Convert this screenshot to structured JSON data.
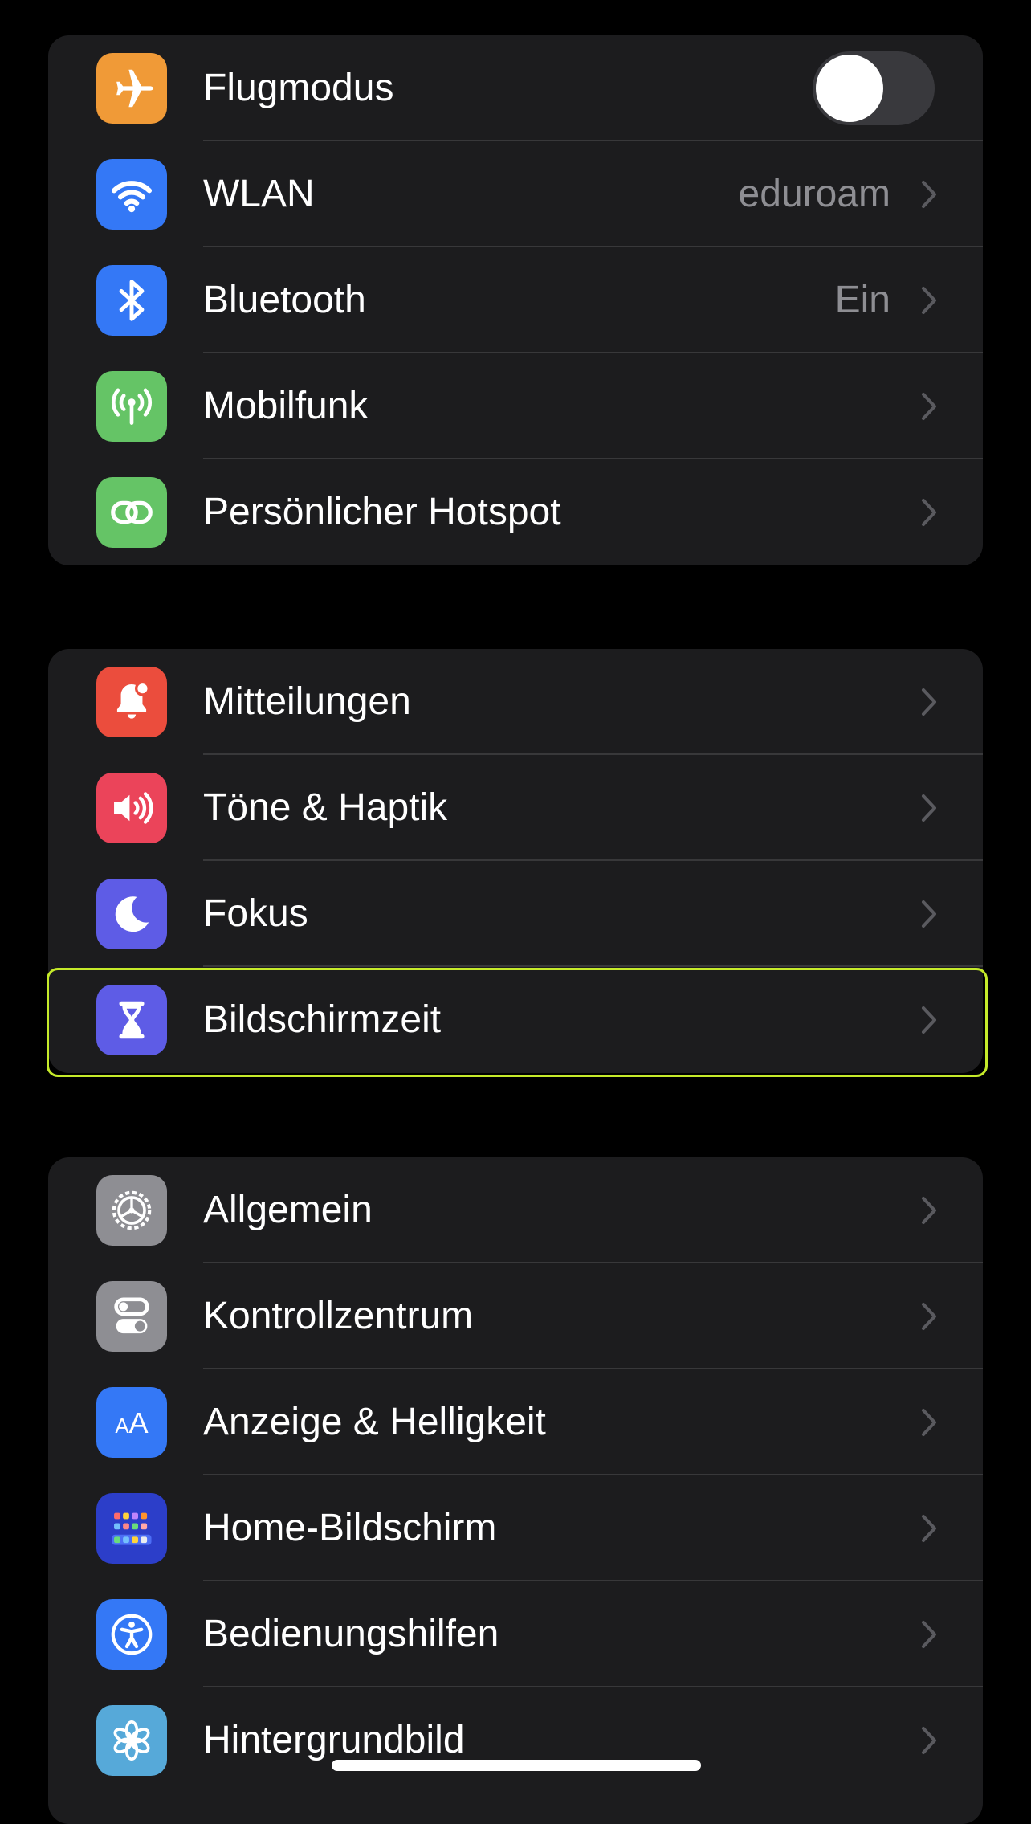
{
  "groups": [
    {
      "rows": [
        {
          "label": "Flugmodus",
          "icon": "airplane-icon",
          "icon_color": "#f09a37",
          "control": "toggle",
          "toggle_on": false
        },
        {
          "label": "WLAN",
          "value": "eduroam",
          "icon": "wifi-icon",
          "icon_color": "#3478f6"
        },
        {
          "label": "Bluetooth",
          "value": "Ein",
          "icon": "bluetooth-icon",
          "icon_color": "#3478f6"
        },
        {
          "label": "Mobilfunk",
          "icon": "antenna-icon",
          "icon_color": "#65c466"
        },
        {
          "label": "Persönlicher Hotspot",
          "icon": "hotspot-link-icon",
          "icon_color": "#65c466"
        }
      ]
    },
    {
      "rows": [
        {
          "label": "Mitteilungen",
          "icon": "bell-icon",
          "icon_color": "#eb4d3d"
        },
        {
          "label": "Töne & Haptik",
          "icon": "speaker-icon",
          "icon_color": "#eb445a"
        },
        {
          "label": "Fokus",
          "icon": "moon-icon",
          "icon_color": "#5e5ce6"
        },
        {
          "label": "Bildschirmzeit",
          "icon": "hourglass-icon",
          "icon_color": "#5e5ce6",
          "highlighted": true,
          "highlight_color": "#c5ea2a"
        }
      ]
    },
    {
      "rows": [
        {
          "label": "Allgemein",
          "icon": "gear-icon",
          "icon_color": "#8e8e93"
        },
        {
          "label": "Kontrollzentrum",
          "icon": "toggles-icon",
          "icon_color": "#8e8e93"
        },
        {
          "label": "Anzeige & Helligkeit",
          "icon": "text-size-icon",
          "icon_color": "#3478f6",
          "icon_text": "AA"
        },
        {
          "label": "Home-Bildschirm",
          "icon": "app-grid-icon",
          "icon_color": "#2c3ec9"
        },
        {
          "label": "Bedienungshilfen",
          "icon": "accessibility-icon",
          "icon_color": "#3478f6"
        },
        {
          "label": "Hintergrundbild",
          "icon": "flower-icon",
          "icon_color": "#56a9d9"
        }
      ]
    }
  ]
}
